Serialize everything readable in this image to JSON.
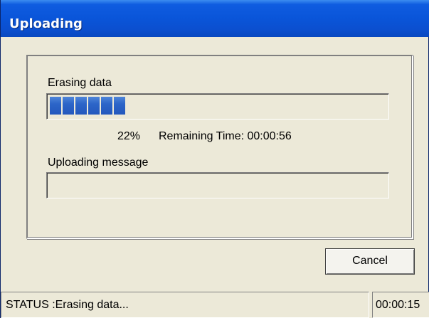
{
  "window": {
    "title": "Uploading"
  },
  "erase_group": {
    "label": "Erasing data",
    "progress_percent": 22,
    "percent_text": "22%",
    "remaining_text": "Remaining Time: 00:00:56"
  },
  "upload_group": {
    "label": "Uploading message",
    "progress_percent": 0
  },
  "buttons": {
    "cancel_label": "Cancel"
  },
  "status_bar": {
    "status_text": "STATUS :Erasing data...",
    "elapsed_time": "00:00:15"
  },
  "colors": {
    "titlebar": "#0a55d9",
    "dialog_bg": "#ece9d8",
    "progress_block": "#2c65c8"
  }
}
